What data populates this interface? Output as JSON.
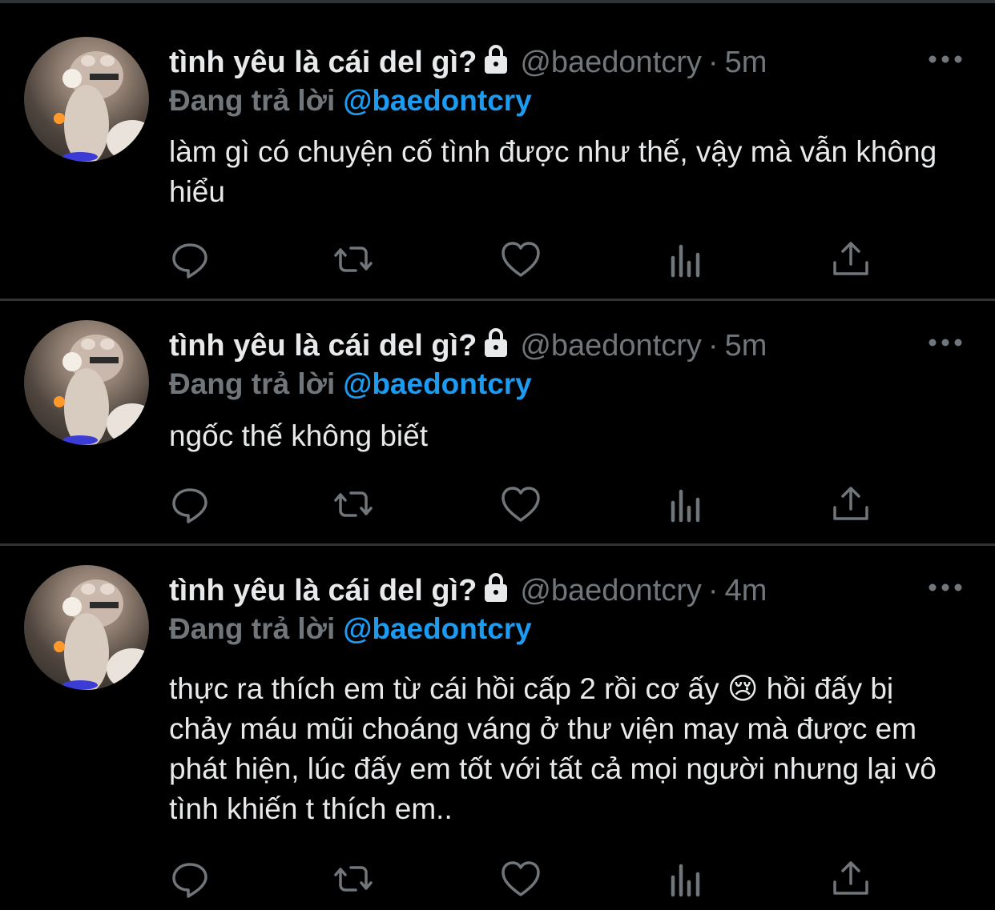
{
  "colors": {
    "background": "#000000",
    "divider": "#2f3336",
    "text_primary": "#e7e9ea",
    "text_secondary": "#71767b",
    "accent": "#1d9bf0"
  },
  "icons": {
    "lock": "lock-icon",
    "more": "more-horizontal-icon",
    "reply": "reply-icon",
    "retweet": "retweet-icon",
    "like": "heart-icon",
    "analytics": "analytics-icon",
    "share": "share-icon"
  },
  "tweets": [
    {
      "display_name": "tình yêu là cái del gì?",
      "handle": "@baedontcry",
      "dot": "·",
      "time": "5m",
      "reply_prefix": "Đang trả lời",
      "reply_handle": "@baedontcry",
      "text": "làm gì có chuyện cố tình được như thế, vậy mà vẫn không hiểu"
    },
    {
      "display_name": "tình yêu là cái del gì?",
      "handle": "@baedontcry",
      "dot": "·",
      "time": "5m",
      "reply_prefix": "Đang trả lời",
      "reply_handle": "@baedontcry",
      "text": "ngốc thế không biết"
    },
    {
      "display_name": "tình yêu là cái del gì?",
      "handle": "@baedontcry",
      "dot": "·",
      "time": "4m",
      "reply_prefix": "Đang trả lời",
      "reply_handle": "@baedontcry",
      "text": "thực ra thích em từ cái hồi cấp 2 rồi cơ ấy 😢  hồi đấy bị chảy máu mũi choáng váng ở thư viện may mà được em phát hiện, lúc đấy em tốt với tất cả mọi người nhưng lại vô tình khiến t thích em.."
    }
  ]
}
